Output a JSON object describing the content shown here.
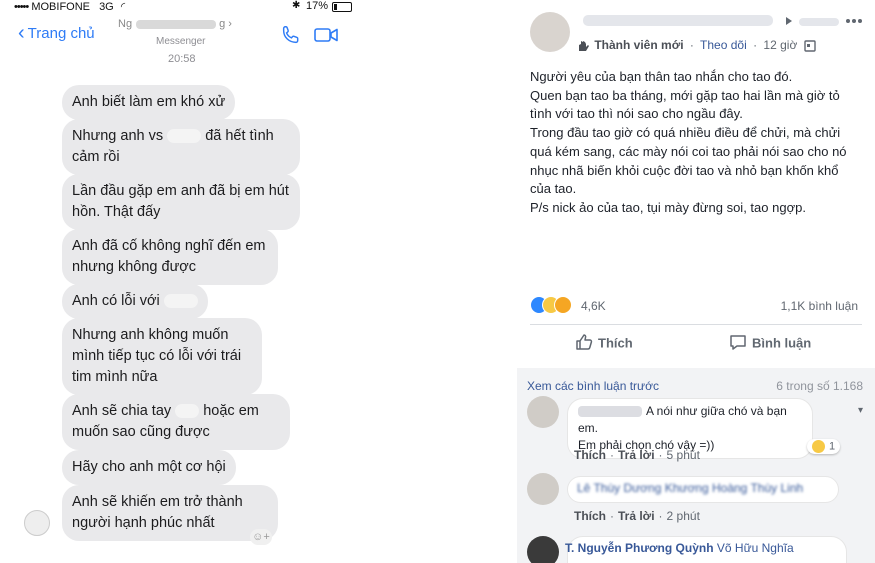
{
  "phone": {
    "status": {
      "carrier": "MOBIFONE",
      "network": "3G",
      "battery": "17%",
      "battery_level": 0.17
    },
    "nav": {
      "back_label": "Trang chủ",
      "contact_name": "Ng",
      "contact_suffix": "g ›",
      "subtitle": "Messenger"
    },
    "time": "20:58",
    "messages": [
      {
        "text": "Anh biết làm em khó xử"
      },
      {
        "text_before": "Nhưng anh vs",
        "text_after": "đã hết tình cảm rồi"
      },
      {
        "text": "Lần đầu gặp em anh đã bị em hút hồn. Thật đấy"
      },
      {
        "text": "Anh đã cố không nghĩ đến em nhưng không được"
      },
      {
        "text_before": "Anh có lỗi với"
      },
      {
        "text": "Nhưng anh không muốn mình tiếp tục có lỗi với trái tim mình nữa"
      },
      {
        "text_before": "Anh sẽ chia tay",
        "text_after": "hoặc em muốn sao cũng được"
      },
      {
        "text": "Hãy cho anh một cơ hội"
      },
      {
        "text": "Anh sẽ khiến em trở thành người hạnh phúc nhất"
      }
    ]
  },
  "fb": {
    "meta": {
      "badge": "Thành viên mới",
      "follow": "Theo dõi",
      "time": "12 giờ"
    },
    "post_lines": [
      "Người yêu của bạn thân tao nhắn cho tao đó.",
      "Quen bạn tao ba tháng, mới gặp tao hai lần mà giờ tỏ tình với tao thì nói sao cho ngầu đây.",
      "Trong đầu tao giờ có quá nhiều điều để chửi, mà chửi quá kém sang, các mày nói coi tao phải nói sao cho nó nhục nhã biến khỏi cuộc đời tao và nhỏ bạn khốn khổ của tao.",
      "P/s nick ảo của tao, tụi mày đừng soi, tao ngợp."
    ],
    "reaction_count": "4,6K",
    "comment_count": "1,1K bình luận",
    "like_label": "Thích",
    "comment_label": "Bình luận",
    "prev_comments": "Xem các bình luận trước",
    "comment_of": "6 trong số 1.168",
    "comments": [
      {
        "text_first": "A nói như giữa chó và bạn em.",
        "text_second": "Em phải chọn chó vậy =))",
        "reaction_count": "1",
        "like": "Thích",
        "reply": "Trả lời",
        "time": "5 phút"
      },
      {
        "text": "Lê Thùy Dương Khương Hoàng Thùy Linh",
        "like": "Thích",
        "reply": "Trả lời",
        "time": "2 phút"
      }
    ],
    "last_comment": {
      "name": "T. Nguyễn Phương Quỳnh",
      "tag": "Võ Hữu Nghĩa"
    },
    "colors": {
      "link": "#385898",
      "ios_blue": "#2f7cf6",
      "bubble": "#e9e9eb"
    }
  }
}
